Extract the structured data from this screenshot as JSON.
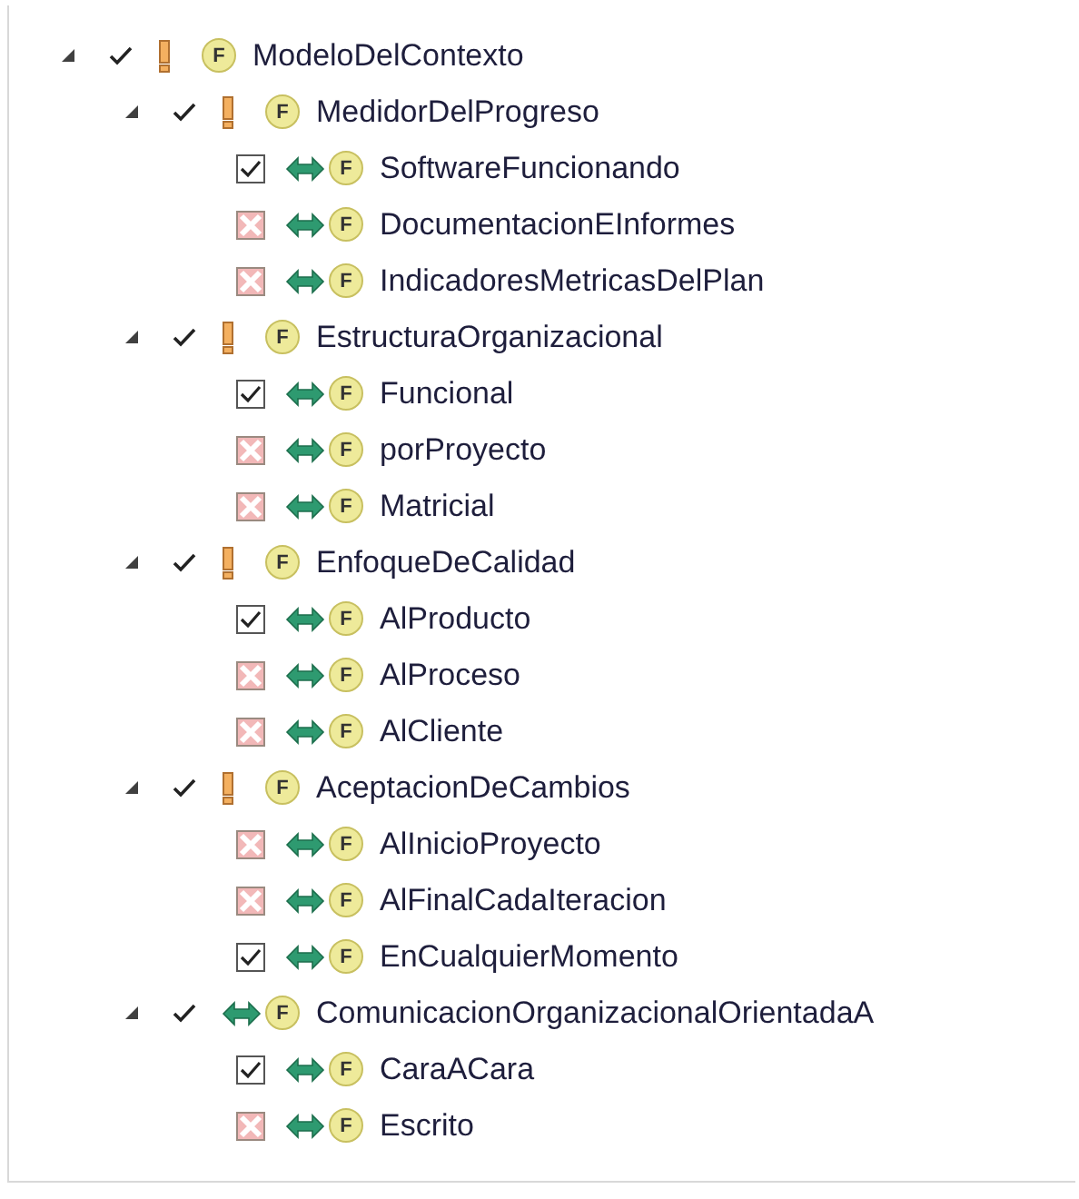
{
  "tree": [
    {
      "name": "ModeloDelContexto",
      "badge": "F",
      "kind": "mandatory",
      "checked": true,
      "expanded": true,
      "children": [
        {
          "name": "MedidorDelProgreso",
          "badge": "F",
          "kind": "mandatory",
          "checked": true,
          "expanded": true,
          "children": [
            {
              "name": "SoftwareFuncionando",
              "badge": "F",
              "kind": "alternative",
              "checked": true
            },
            {
              "name": "DocumentacionEInformes",
              "badge": "F",
              "kind": "alternative",
              "checked": false
            },
            {
              "name": "IndicadoresMetricasDelPlan",
              "badge": "F",
              "kind": "alternative",
              "checked": false
            }
          ]
        },
        {
          "name": "EstructuraOrganizacional",
          "badge": "F",
          "kind": "mandatory",
          "checked": true,
          "expanded": true,
          "children": [
            {
              "name": "Funcional",
              "badge": "F",
              "kind": "alternative",
              "checked": true
            },
            {
              "name": "porProyecto",
              "badge": "F",
              "kind": "alternative",
              "checked": false
            },
            {
              "name": "Matricial",
              "badge": "F",
              "kind": "alternative",
              "checked": false
            }
          ]
        },
        {
          "name": "EnfoqueDeCalidad",
          "badge": "F",
          "kind": "mandatory",
          "checked": true,
          "expanded": true,
          "children": [
            {
              "name": "AlProducto",
              "badge": "F",
              "kind": "alternative",
              "checked": true
            },
            {
              "name": "AlProceso",
              "badge": "F",
              "kind": "alternative",
              "checked": false
            },
            {
              "name": "AlCliente",
              "badge": "F",
              "kind": "alternative",
              "checked": false
            }
          ]
        },
        {
          "name": "AceptacionDeCambios",
          "badge": "F",
          "kind": "mandatory",
          "checked": true,
          "expanded": true,
          "children": [
            {
              "name": "AlInicioProyecto",
              "badge": "F",
              "kind": "alternative",
              "checked": false
            },
            {
              "name": "AlFinalCadaIteracion",
              "badge": "F",
              "kind": "alternative",
              "checked": false
            },
            {
              "name": "EnCualquierMomento",
              "badge": "F",
              "kind": "alternative",
              "checked": true
            }
          ]
        },
        {
          "name": "ComunicacionOrganizacionalOrientadaA",
          "badge": "F",
          "kind": "alternative",
          "checked": true,
          "expanded": true,
          "children": [
            {
              "name": "CaraACara",
              "badge": "F",
              "kind": "alternative",
              "checked": true
            },
            {
              "name": "Escrito",
              "badge": "F",
              "kind": "alternative",
              "checked": false
            }
          ]
        }
      ]
    }
  ]
}
